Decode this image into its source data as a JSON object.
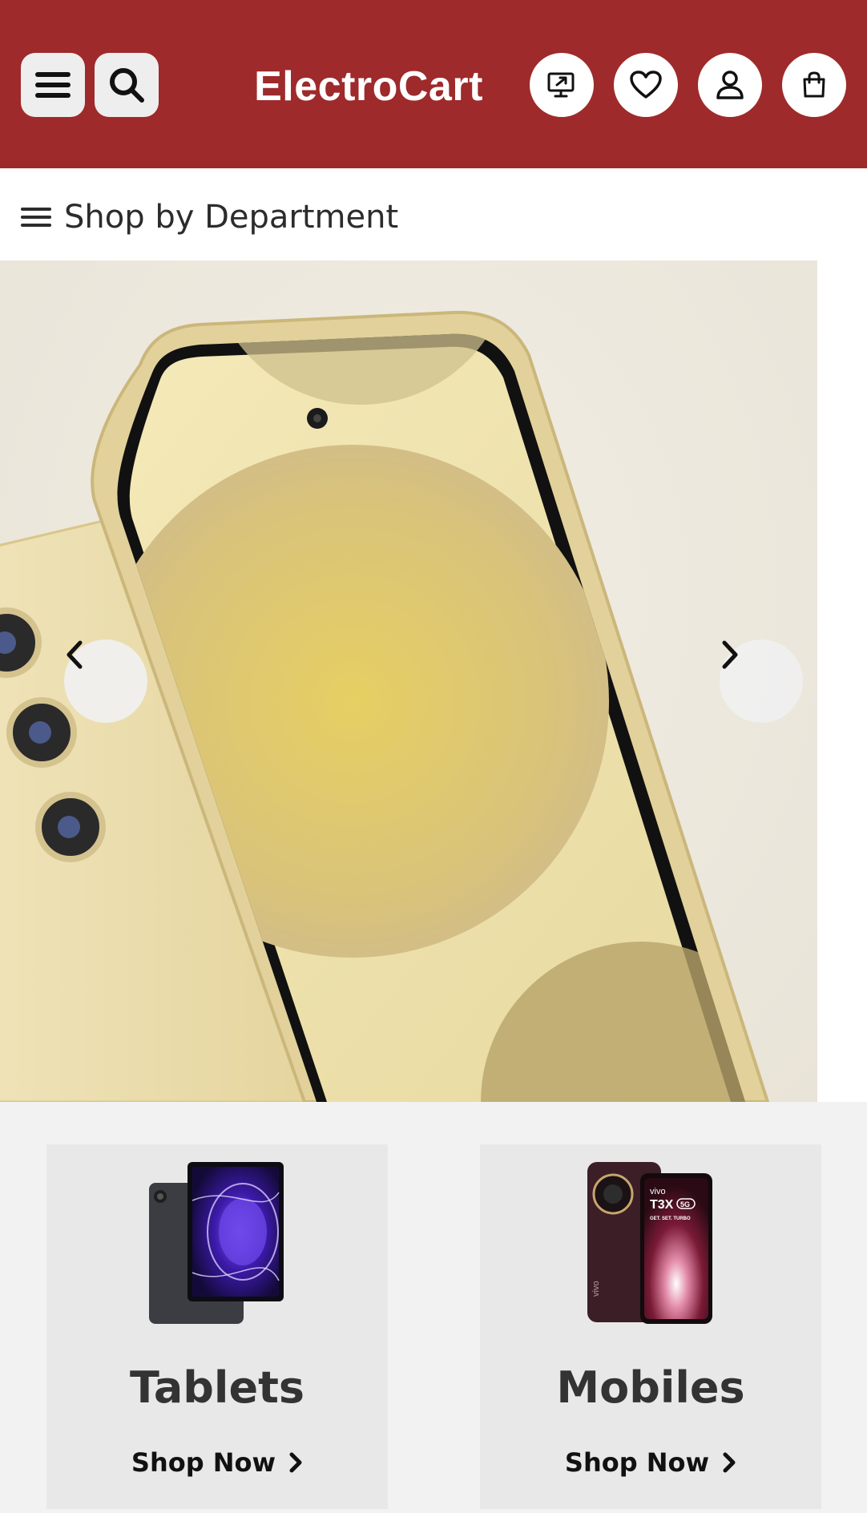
{
  "header": {
    "brand": "ElectroCart",
    "background_color": "#9e2a2b",
    "left_buttons": [
      {
        "name": "menu",
        "icon": "hamburger-icon"
      },
      {
        "name": "search",
        "icon": "search-icon"
      }
    ],
    "right_buttons": [
      {
        "name": "compare",
        "icon": "monitor-share-icon"
      },
      {
        "name": "wishlist",
        "icon": "heart-icon"
      },
      {
        "name": "account",
        "icon": "user-icon"
      },
      {
        "name": "cart",
        "icon": "shopping-bag-icon"
      }
    ]
  },
  "department_menu": {
    "label": "Shop by Department",
    "icon": "hamburger-icon"
  },
  "hero_carousel": {
    "slide_image": "golden smartphone front and back",
    "prev_icon": "chevron-left-icon",
    "next_icon": "chevron-right-icon"
  },
  "categories": [
    {
      "title": "Tablets",
      "cta": "Shop Now",
      "cta_icon": "chevron-right-icon",
      "image": "tablet product"
    },
    {
      "title": "Mobiles",
      "cta": "Shop Now",
      "cta_icon": "chevron-right-icon",
      "image": "vivo T3X 5G phones"
    }
  ],
  "mobiles_image_text": {
    "brand": "vivo",
    "model": "T3X",
    "badge": "5G",
    "tagline": "GET. SET. TURBO"
  }
}
